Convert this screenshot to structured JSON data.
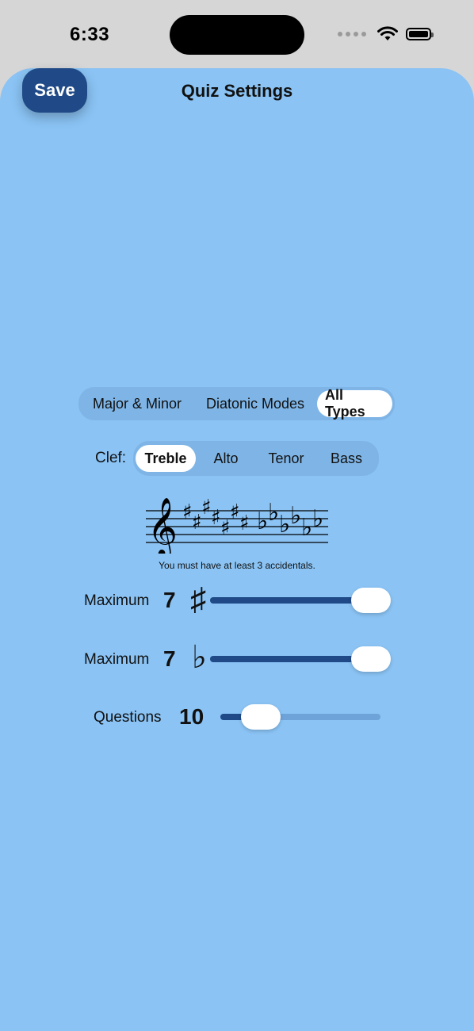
{
  "status_bar": {
    "time": "6:33"
  },
  "header": {
    "title": "Quiz Settings",
    "save_label": "Save"
  },
  "type_selector": {
    "options": [
      "Major & Minor",
      "Diatonic Modes",
      "All Types"
    ],
    "selected": "All Types"
  },
  "clef_selector": {
    "label": "Clef:",
    "options": [
      "Treble",
      "Alto",
      "Tenor",
      "Bass"
    ],
    "selected": "Treble"
  },
  "staff_note": "You must have at least 3 accidentals.",
  "sliders": {
    "max_sharps": {
      "label": "Maximum",
      "value": "7",
      "symbol": "♯",
      "fraction": 1.0
    },
    "max_flats": {
      "label": "Maximum",
      "value": "7",
      "symbol": "♭",
      "fraction": 1.0
    },
    "questions": {
      "label": "Questions",
      "value": "10",
      "fraction": 0.17
    }
  },
  "colors": {
    "background": "#8ac3f4",
    "accent": "#1f4a87",
    "track": "#6ea3d9"
  }
}
